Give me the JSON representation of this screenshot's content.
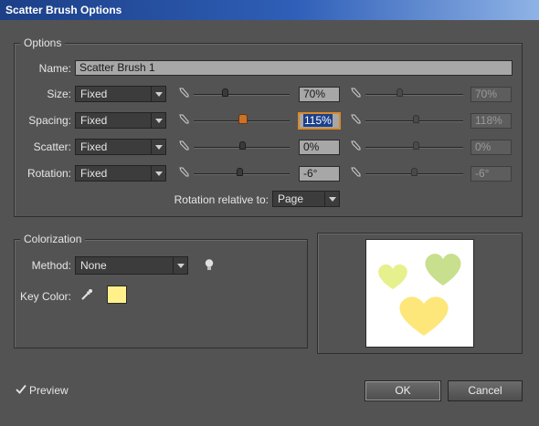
{
  "window": {
    "title": "Scatter Brush Options"
  },
  "options": {
    "group_label": "Options",
    "name_label": "Name:",
    "name_value": "Scatter Brush 1",
    "rows": [
      {
        "label": "Size:",
        "mode": "Fixed",
        "value": "70%",
        "value2": "70%"
      },
      {
        "label": "Spacing:",
        "mode": "Fixed",
        "value": "115%",
        "value2": "118%"
      },
      {
        "label": "Scatter:",
        "mode": "Fixed",
        "value": "0%",
        "value2": "0%"
      },
      {
        "label": "Rotation:",
        "mode": "Fixed",
        "value": "-6°",
        "value2": "-6°"
      }
    ],
    "rotation_relative_label": "Rotation relative to:",
    "rotation_relative_value": "Page"
  },
  "colorization": {
    "group_label": "Colorization",
    "method_label": "Method:",
    "method_value": "None",
    "key_color_label": "Key Color:",
    "key_color": "#fff08a"
  },
  "preview": {
    "label": "Preview",
    "checked": true,
    "heart_colors": [
      "#e6f08c",
      "#c8df8e",
      "#fde77a"
    ]
  },
  "buttons": {
    "ok": "OK",
    "cancel": "Cancel"
  }
}
